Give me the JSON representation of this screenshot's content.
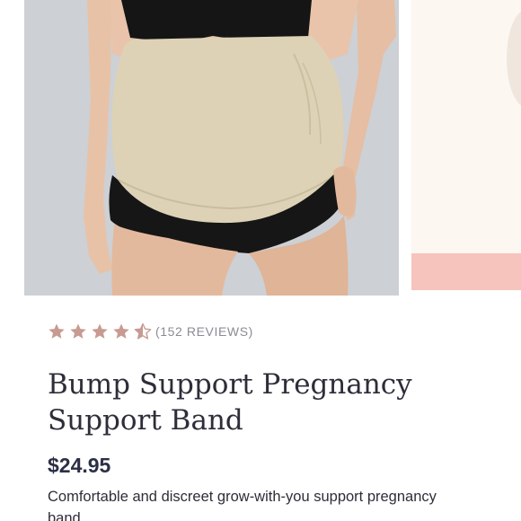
{
  "carousel": {
    "main_image_alt": "Bump Support Pregnancy Support Band worn by pregnant model",
    "next_image_alt": "Next product image"
  },
  "rating": {
    "value": 4.5,
    "max": 5,
    "reviews_label": "(152 REVIEWS)",
    "star_color": "#c79a92"
  },
  "product": {
    "title": "Bump Support Pregnancy Support Band",
    "price": "$24.95",
    "description": "Comfortable and discreet grow-with-you support pregnancy band."
  },
  "colors": {
    "text_dark": "#2e2e3a",
    "muted": "#8b8b95",
    "accent_pink": "#f6c3bd"
  }
}
